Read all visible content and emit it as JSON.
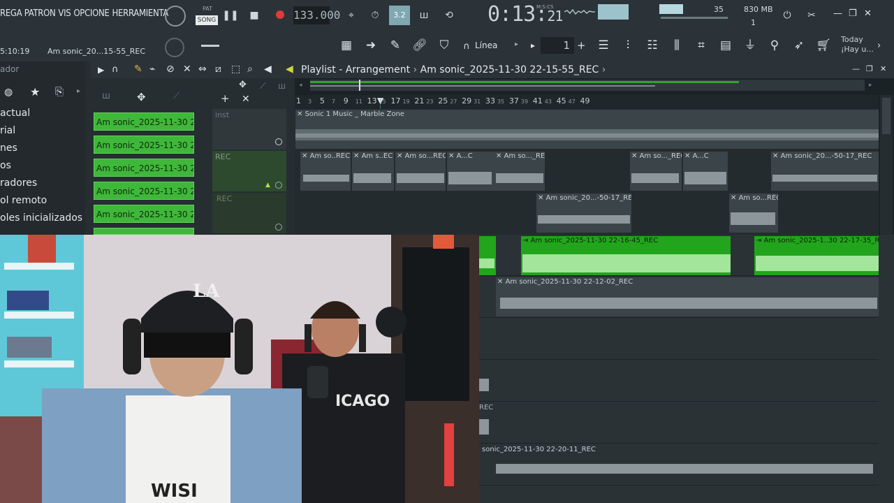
{
  "topbar": {
    "menu": [
      "REGA PATRON",
      "VIS",
      "OPCIONE",
      "HERRAMIENTA"
    ],
    "pattern_label": "PAT",
    "song_label": "SONG",
    "tempo": "133.000",
    "time_main": "0:13:",
    "time_frac": "21",
    "time_unit": "M:S:CS",
    "cpu_value": "35",
    "ram": "830 MB",
    "voices": "1",
    "hint_time": "5:10:19",
    "hint_file": "Am sonic_20...15-55_REC",
    "snap_label": "Línea",
    "pattern_number": "1",
    "today": "Today",
    "today_sub": "¡Hay u..."
  },
  "browser": {
    "title": "ador",
    "items": [
      "actual",
      "rial",
      "nes",
      "os",
      "radores",
      "ol remoto",
      "oles inicializados"
    ]
  },
  "channels": [
    "Am sonic_2025-11-30 2...",
    "Am sonic_2025-11-30 2...",
    "Am sonic_2025-11-30 2...",
    "Am sonic_2025-11-30 2...",
    "Am sonic_2025-11-30 2..."
  ],
  "playlist": {
    "title": "Playlist - Arrangement",
    "pattern": "Am sonic_2025-11-30 22-15-55_REC",
    "ruler": [
      "1",
      "5",
      "9",
      "13",
      "17",
      "21",
      "25",
      "29",
      "33",
      "37",
      "41",
      "45",
      "49"
    ],
    "ruler_minor": [
      "3",
      "7",
      "11",
      "15",
      "19",
      "23",
      "27",
      "31",
      "35",
      "39",
      "43",
      "47"
    ],
    "track_names": [
      "inst",
      "REC",
      "REC"
    ],
    "clips": {
      "inst": "Sonic 1 Music _ Marble Zone",
      "rec1": [
        "Am so..REC",
        "Am s..EC",
        "Am so...REC",
        "A...C",
        "Am so..._REC",
        "Am so..._REC",
        "A...C",
        "Am sonic_20...-50-17_REC"
      ],
      "rec2": [
        "Am sonic_20...-50-17_REC",
        "Am so...REC"
      ],
      "lower": [
        "Am sonic_2025-11-30 22-16-45_REC",
        "Am sonic_2025-1..30 22-17-35_REC",
        "Am sonic_2025-11-30 22-12-02_REC",
        "REC",
        "sonic_2025-11-30 22-20-11_REC"
      ]
    }
  },
  "webcam": {
    "cap_text": "LA",
    "shirt_text": "ICAGO",
    "shirt_text2": "WISI"
  },
  "colors": {
    "accent_green": "#3fb73a",
    "background": "#1b2226"
  }
}
